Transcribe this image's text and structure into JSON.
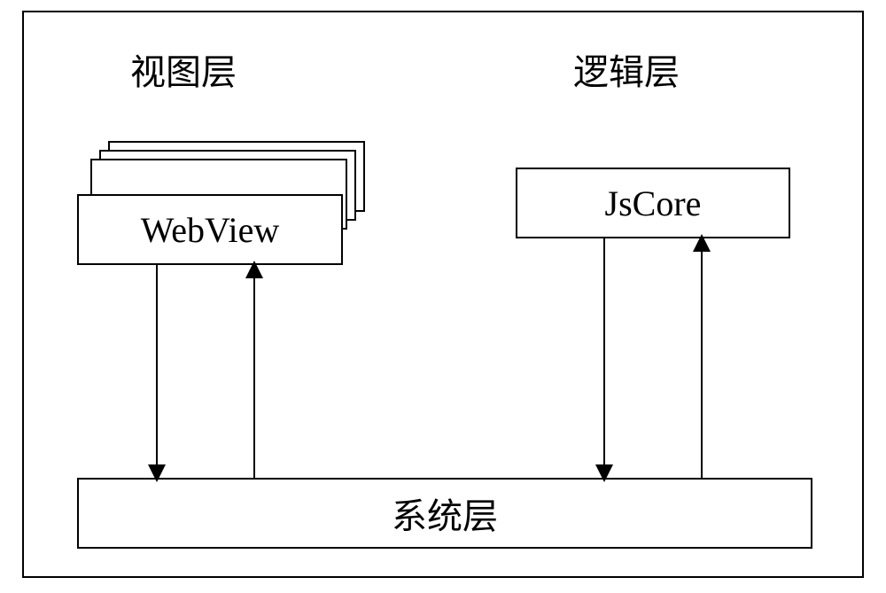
{
  "headings": {
    "view_layer": "视图层",
    "logic_layer": "逻辑层"
  },
  "boxes": {
    "webview": "WebView",
    "jscore": "JsCore",
    "system_layer": "系统层"
  }
}
